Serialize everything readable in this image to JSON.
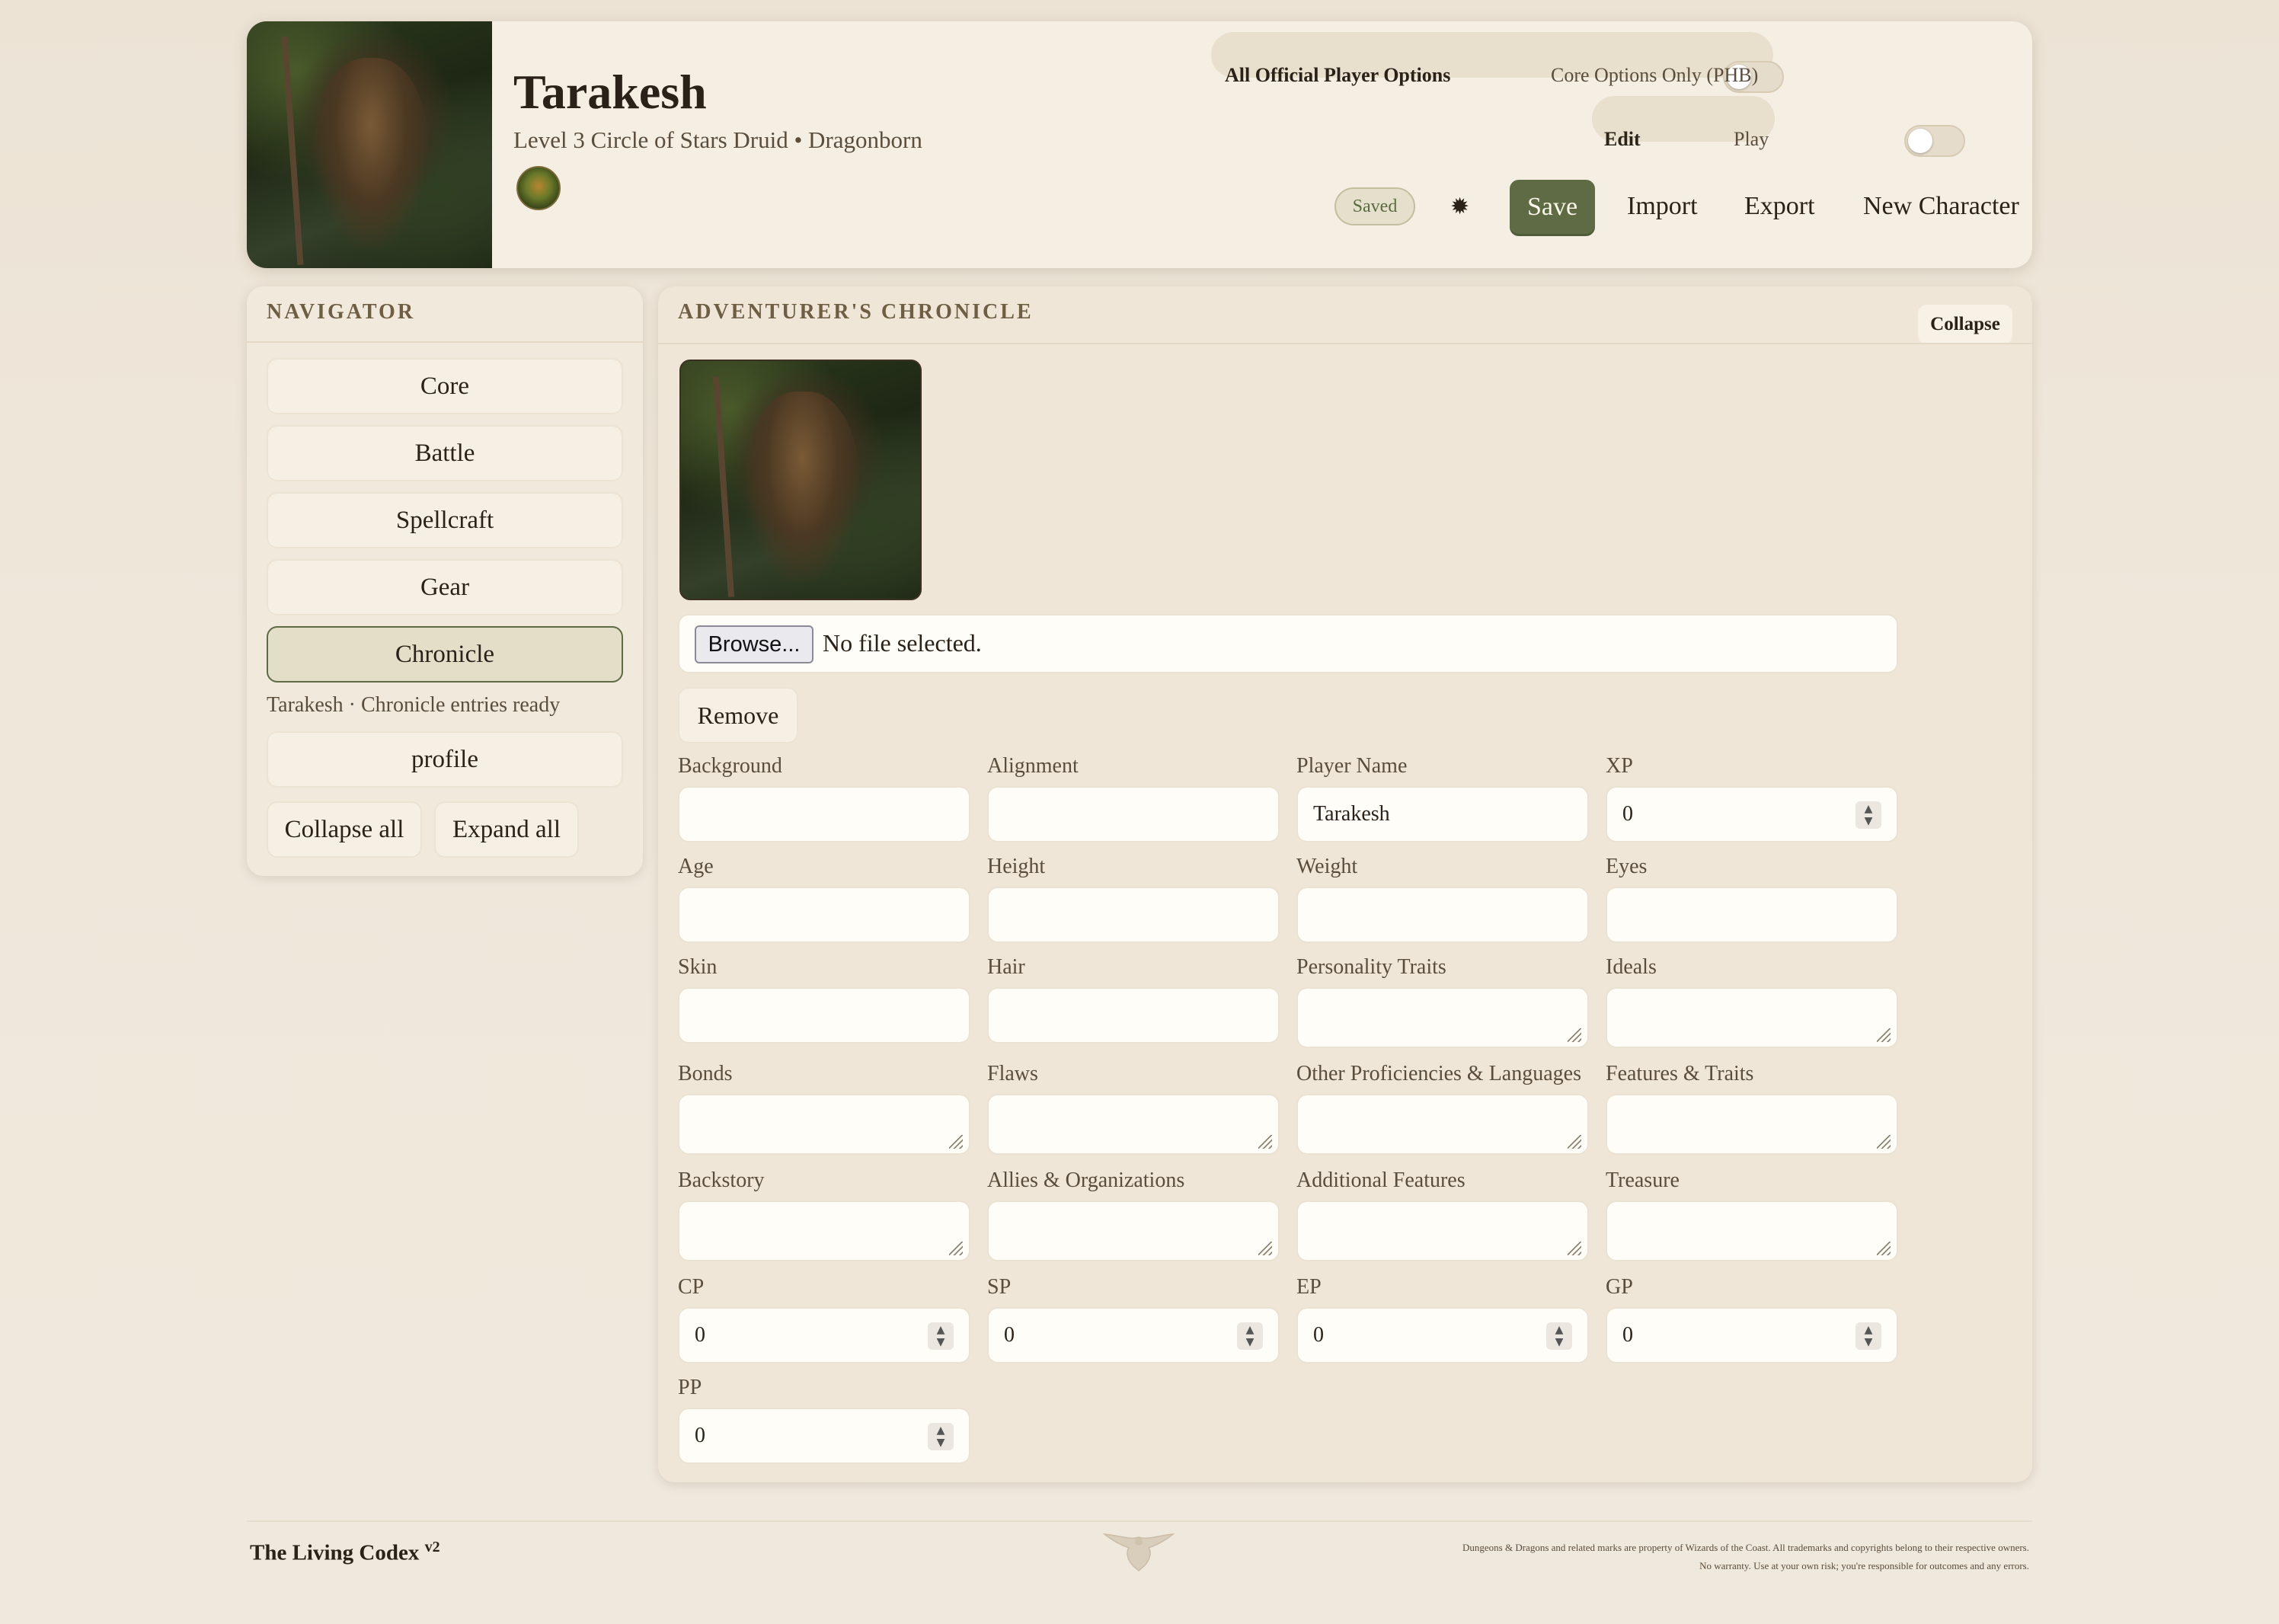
{
  "header": {
    "name": "Tarakesh",
    "subtitle": "Level 3 Circle of Stars Druid • Dragonborn",
    "options_left": "All Official Player Options",
    "options_right": "Core Options Only (PHB)",
    "edit_label": "Edit",
    "play_label": "Play",
    "saved_badge": "Saved",
    "settings_glyph": "✹",
    "save": "Save",
    "import": "Import",
    "export": "Export",
    "new_character": "New Character"
  },
  "navigator": {
    "title": "NAVIGATOR",
    "items": [
      "Core",
      "Battle",
      "Spellcraft",
      "Gear",
      "Chronicle"
    ],
    "active": "Chronicle",
    "status": "Tarakesh · Chronicle entries ready",
    "profile": "profile",
    "collapse_all": "Collapse all",
    "expand_all": "Expand all"
  },
  "chronicle": {
    "title": "ADVENTURER'S CHRONICLE",
    "collapse": "Collapse",
    "browse": "Browse...",
    "file_status": "No file selected.",
    "remove": "Remove",
    "fields": {
      "background": {
        "label": "Background",
        "value": ""
      },
      "alignment": {
        "label": "Alignment",
        "value": ""
      },
      "player_name": {
        "label": "Player Name",
        "value": "Tarakesh"
      },
      "xp": {
        "label": "XP",
        "value": "0"
      },
      "age": {
        "label": "Age",
        "value": ""
      },
      "height": {
        "label": "Height",
        "value": ""
      },
      "weight": {
        "label": "Weight",
        "value": ""
      },
      "eyes": {
        "label": "Eyes",
        "value": ""
      },
      "skin": {
        "label": "Skin",
        "value": ""
      },
      "hair": {
        "label": "Hair",
        "value": ""
      },
      "personality": {
        "label": "Personality Traits",
        "value": ""
      },
      "ideals": {
        "label": "Ideals",
        "value": ""
      },
      "bonds": {
        "label": "Bonds",
        "value": ""
      },
      "flaws": {
        "label": "Flaws",
        "value": ""
      },
      "other_prof": {
        "label": "Other Proficiencies & Languages",
        "value": ""
      },
      "features": {
        "label": "Features & Traits",
        "value": ""
      },
      "backstory": {
        "label": "Backstory",
        "value": ""
      },
      "allies": {
        "label": "Allies & Organizations",
        "value": ""
      },
      "additional": {
        "label": "Additional Features",
        "value": ""
      },
      "treasure": {
        "label": "Treasure",
        "value": ""
      },
      "cp": {
        "label": "CP",
        "value": "0"
      },
      "sp": {
        "label": "SP",
        "value": "0"
      },
      "ep": {
        "label": "EP",
        "value": "0"
      },
      "gp": {
        "label": "GP",
        "value": "0"
      },
      "pp": {
        "label": "PP",
        "value": "0"
      }
    }
  },
  "footer": {
    "brand": "The Living Codex",
    "version": "v2",
    "legal_1": "Dungeons & Dragons and related marks are property of Wizards of the Coast. All trademarks and copyrights belong to their respective owners.",
    "legal_2": "No warranty. Use at your own risk; you're responsible for outcomes and any errors."
  },
  "colors": {
    "accent": "#5e6b44",
    "panel": "#efe6d8",
    "background": "#efe7da"
  },
  "icons": [
    "character-portrait",
    "class-emblem-icon",
    "settings-icon",
    "spinner-icon",
    "resize-grip-icon",
    "eagle-emblem-icon"
  ]
}
